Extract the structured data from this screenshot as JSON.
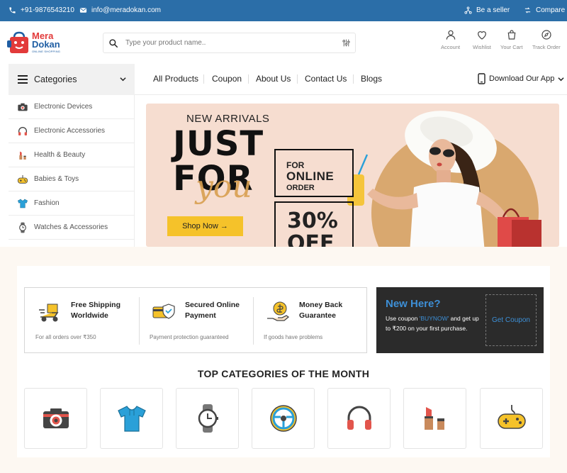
{
  "topbar": {
    "phone": "+91-9876543210",
    "email": "info@meradokan.com",
    "seller": "Be a seller",
    "compare": "Compare"
  },
  "brand": {
    "name_line1": "Mera",
    "name_line2": "Dokan",
    "tagline": "ONLINE SHOPPING"
  },
  "search": {
    "placeholder": "Type your product name.."
  },
  "header_icons": [
    {
      "label": "Account",
      "icon": "user-icon"
    },
    {
      "label": "Wishlist",
      "icon": "heart-icon"
    },
    {
      "label": "Your Cart",
      "icon": "cart-icon"
    },
    {
      "label": "Track Order",
      "icon": "compass-icon"
    }
  ],
  "categories": {
    "label": "Categories",
    "items": [
      {
        "label": "Electronic Devices",
        "icon": "camera-icon"
      },
      {
        "label": "Electronic Accessories",
        "icon": "headphones-icon"
      },
      {
        "label": "Health & Beauty",
        "icon": "lipstick-icon"
      },
      {
        "label": "Babies & Toys",
        "icon": "gamepad-icon"
      },
      {
        "label": "Fashion",
        "icon": "tshirt-icon"
      },
      {
        "label": "Watches & Accessories",
        "icon": "watch-icon"
      }
    ]
  },
  "nav": {
    "items": [
      "All Products",
      "Coupon",
      "About Us",
      "Contact Us",
      "Blogs"
    ],
    "app": "Download Our App"
  },
  "hero": {
    "subtitle": "NEW ARRIVALS",
    "title_line1": "JUST",
    "title_line2": "FOR",
    "script": "you",
    "box_line1": "FOR",
    "box_line2": "ONLINE",
    "box_line3": "ORDER",
    "discount_line1": "30%",
    "discount_line2": "OFF",
    "cta": "Shop Now →"
  },
  "features": [
    {
      "title_line1": "Free Shipping",
      "title_line2": "Worldwide",
      "sub": "For all orders over ₹350",
      "icon": "delivery-scooter-icon"
    },
    {
      "title_line1": "Secured Online",
      "title_line2": "Payment",
      "sub": "Payment protection guaranteed",
      "icon": "secure-card-icon"
    },
    {
      "title_line1": "Money Back",
      "title_line2": "Guarantee",
      "sub": "If goods have problems",
      "icon": "money-back-icon"
    }
  ],
  "promo": {
    "title": "New Here?",
    "text_before": "Use coupon ",
    "coupon": "'BUYNOW'",
    "text_after": " and get up to ₹200 on your first purchase.",
    "button": "Get Coupon"
  },
  "top_categories": {
    "title": "TOP CATEGORIES OF THE MONTH",
    "icons": [
      "camera-icon",
      "tshirt-icon",
      "watch-icon",
      "steering-wheel-icon",
      "headphones-icon",
      "lipstick-icon",
      "gamepad-icon"
    ]
  },
  "colors": {
    "topbar": "#2b6ea8",
    "accent_blue": "#3d8fd6",
    "cta_yellow": "#f5c22a",
    "hero_bg": "#f6ddd0",
    "promo_bg": "#2b2b2b"
  }
}
